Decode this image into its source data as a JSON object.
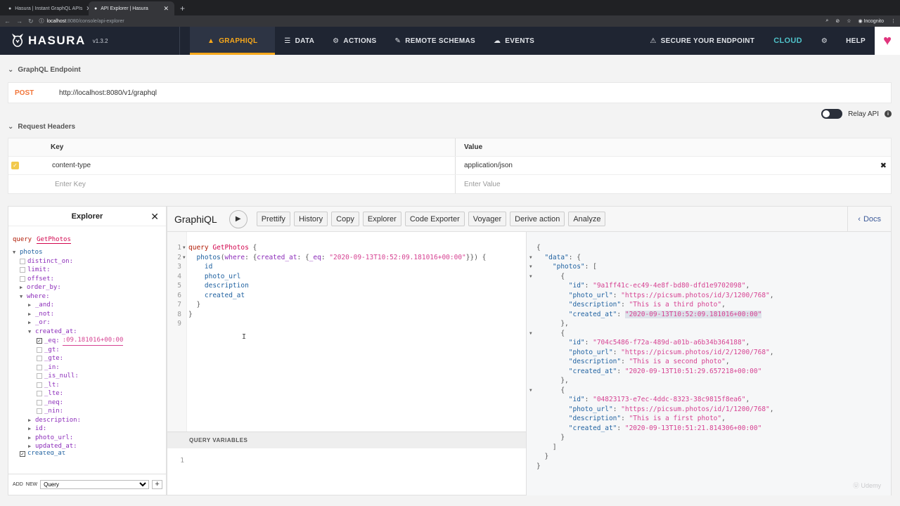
{
  "browser": {
    "tabs": [
      {
        "title": "Hasura | Instant GraphQL APIs"
      },
      {
        "title": "API Explorer | Hasura"
      }
    ],
    "address_host": "localhost",
    "address_path": ":8080/console/api-explorer",
    "incognito_label": "Incognito"
  },
  "nav": {
    "brand": "HASURA",
    "version": "v1.3.2",
    "items": [
      {
        "label": "GRAPHIQL"
      },
      {
        "label": "DATA"
      },
      {
        "label": "ACTIONS"
      },
      {
        "label": "REMOTE SCHEMAS"
      },
      {
        "label": "EVENTS"
      }
    ],
    "secure": "SECURE YOUR ENDPOINT",
    "cloud": "CLOUD",
    "help": "HELP"
  },
  "endpoint": {
    "section_title": "GraphQL Endpoint",
    "method": "POST",
    "url": "http://localhost:8080/v1/graphql",
    "relay_label": "Relay API"
  },
  "headers": {
    "section_title": "Request Headers",
    "key_col": "Key",
    "value_col": "Value",
    "row_key": "content-type",
    "row_value": "application/json",
    "key_placeholder": "Enter Key",
    "value_placeholder": "Enter Value"
  },
  "explorer": {
    "title": "Explorer",
    "op_keyword": "query",
    "op_name": "GetPhotos",
    "root": "photos",
    "args": [
      "distinct_on:",
      "limit:",
      "offset:",
      "order_by:",
      "where:"
    ],
    "where_ops": [
      "_and:",
      "_not:",
      "_or:"
    ],
    "created_at": "created_at:",
    "eq_label": "_eq:",
    "eq_value": ":09.181016+00:00",
    "cmp_ops": [
      "_gt:",
      "_gte:",
      "_in:",
      "_is_null:",
      "_lt:",
      "_lte:",
      "_neq:",
      "_nin:"
    ],
    "more_fields": [
      "description:",
      "id:",
      "photo_url:",
      "updated_at:"
    ],
    "cut_field": "created_at",
    "footer_add": "ADD",
    "footer_new": "NEW",
    "footer_select": "Query"
  },
  "graphiql": {
    "title": "GraphiQL",
    "buttons": [
      "Prettify",
      "History",
      "Copy",
      "Explorer",
      "Code Exporter",
      "Voyager",
      "Derive action",
      "Analyze"
    ],
    "docs": "Docs",
    "query_vars_label": "QUERY VARIABLES"
  },
  "query": {
    "keyword": "query",
    "name": "GetPhotos",
    "field": "photos",
    "arg": "where",
    "filter_field": "created_at",
    "filter_op": "_eq",
    "filter_value": "\"2020-09-13T10:52:09.181016+00:00\"",
    "fields": [
      "id",
      "photo_url",
      "description",
      "created_at"
    ]
  },
  "result": {
    "photos": [
      {
        "id": "\"9a1ff41c-ec49-4e8f-bd80-dfd1e9702098\"",
        "photo_url": "\"https://picsum.photos/id/3/1200/768\"",
        "description": "\"This is a third photo\"",
        "created_at": "\"2020-09-13T10:52:09.181016+00:00\""
      },
      {
        "id": "\"704c5486-f72a-489d-a01b-a6b34b364188\"",
        "photo_url": "\"https://picsum.photos/id/2/1200/768\"",
        "description": "\"This is a second photo\"",
        "created_at": "\"2020-09-13T10:51:29.657218+00:00\""
      },
      {
        "id": "\"04823173-e7ec-4ddc-8323-38c9815f8ea6\"",
        "photo_url": "\"https://picsum.photos/id/1/1200/768\"",
        "description": "\"This is a first photo\"",
        "created_at": "\"2020-09-13T10:51:21.814306+00:00\""
      }
    ]
  },
  "watermark": "Udemy",
  "colors": {
    "nav_bg": "#1f2532",
    "accent": "#f7a81b",
    "cloud": "#4fc1c8",
    "post": "#f2763a"
  }
}
